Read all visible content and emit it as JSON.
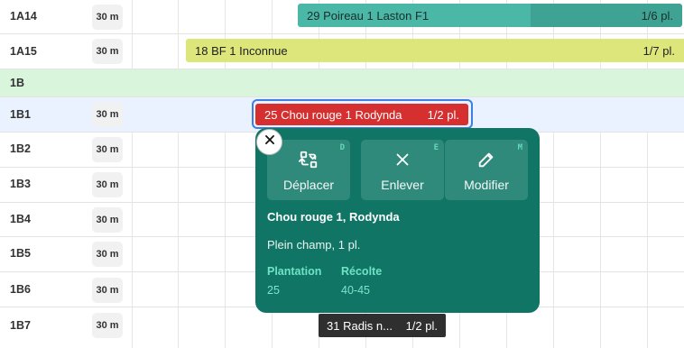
{
  "rows": [
    {
      "label": "1A14",
      "duration": "30 m"
    },
    {
      "label": "1A15",
      "duration": "30 m"
    },
    {
      "label": "1B"
    },
    {
      "label": "1B1",
      "duration": "30 m"
    },
    {
      "label": "1B2",
      "duration": "30 m"
    },
    {
      "label": "1B3",
      "duration": "30 m"
    },
    {
      "label": "1B4",
      "duration": "30 m"
    },
    {
      "label": "1B5",
      "duration": "30 m"
    },
    {
      "label": "1B6",
      "duration": "30 m"
    },
    {
      "label": "1B7",
      "duration": "30 m"
    }
  ],
  "plantings": {
    "poireau": {
      "name": "29 Poireau 1 Laston F1",
      "count": "1/6 pl.",
      "color": "#4bb7a6"
    },
    "bf": {
      "name": "18 BF 1 Inconnue",
      "count": "1/7 pl.",
      "color": "#dce67a"
    },
    "chou": {
      "name": "25 Chou rouge 1 Rodynda",
      "count": "1/2 pl.",
      "color": "#d62f2f"
    },
    "radis": {
      "name": "31 Radis n...",
      "count": "1/2 pl.",
      "color": "#2f2f2f"
    }
  },
  "popup": {
    "close_icon": "close-icon",
    "actions": [
      {
        "label": "Déplacer",
        "key": "D",
        "icon": "swap-icon"
      },
      {
        "label": "Enlever",
        "key": "E",
        "icon": "x-icon"
      },
      {
        "label": "Modifier",
        "key": "M",
        "icon": "pencil-icon"
      }
    ],
    "title": "Chou rouge 1, Rodynda",
    "subtitle": "Plein champ, 1 pl.",
    "plantation_label": "Plantation",
    "plantation_value": "25",
    "recolte_label": "Récolte",
    "recolte_value": "40-45"
  },
  "colors": {
    "popup_bg": "#117565",
    "section_bg": "#d9f6dc",
    "selected_row_bg": "#eaf2ff",
    "selection_ring": "#3f7fe0"
  }
}
